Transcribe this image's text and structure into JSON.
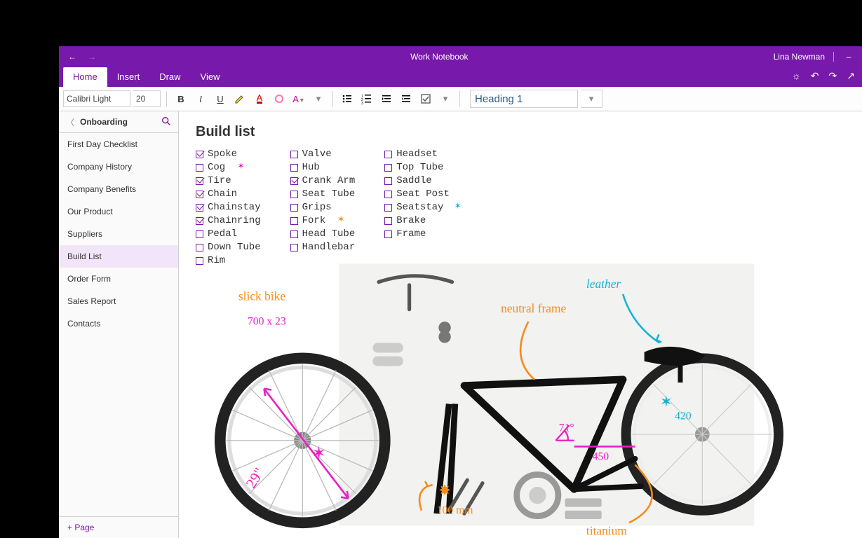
{
  "titlebar": {
    "title": "Work Notebook",
    "user": "Lina Newman"
  },
  "ribbon": {
    "tabs": [
      "Home",
      "Insert",
      "Draw",
      "View"
    ],
    "active": 0
  },
  "toolbar": {
    "font_name": "Calibri Light",
    "font_size": "20",
    "style_name": "Heading 1"
  },
  "sidebar": {
    "section": "Onboarding",
    "pages": [
      "First Day Checklist",
      "Company History",
      "Company Benefits",
      "Our Product",
      "Suppliers",
      "Build List",
      "Order Form",
      "Sales Report",
      "Contacts"
    ],
    "active_index": 5,
    "add_label": "Page"
  },
  "page": {
    "title": "Build list",
    "columns": [
      [
        {
          "label": "Spoke",
          "checked": true
        },
        {
          "label": "Cog",
          "checked": false,
          "star": "magenta"
        },
        {
          "label": "Tire",
          "checked": true
        },
        {
          "label": "Chain",
          "checked": true
        },
        {
          "label": "Chainstay",
          "checked": true
        },
        {
          "label": "Chainring",
          "checked": true
        },
        {
          "label": "Pedal",
          "checked": false
        },
        {
          "label": "Down Tube",
          "checked": false
        },
        {
          "label": "Rim",
          "checked": false
        }
      ],
      [
        {
          "label": "Valve",
          "checked": false
        },
        {
          "label": "Hub",
          "checked": false
        },
        {
          "label": "Crank Arm",
          "checked": true
        },
        {
          "label": "Seat Tube",
          "checked": false
        },
        {
          "label": "Grips",
          "checked": false
        },
        {
          "label": "Fork",
          "checked": false,
          "star": "orange"
        },
        {
          "label": "Head Tube",
          "checked": false
        },
        {
          "label": "Handlebar",
          "checked": false
        }
      ],
      [
        {
          "label": "Headset",
          "checked": false
        },
        {
          "label": "Top Tube",
          "checked": false
        },
        {
          "label": "Saddle",
          "checked": false
        },
        {
          "label": "Seat Post",
          "checked": false
        },
        {
          "label": "Seatstay",
          "checked": false,
          "star": "cyan"
        },
        {
          "label": "Brake",
          "checked": false
        },
        {
          "label": "Frame",
          "checked": false
        }
      ]
    ]
  },
  "annotations": {
    "slick_bike": "slick bike",
    "wheel_size": "700 x 23",
    "rim_size": "29\"",
    "neutral_frame": "neutral frame",
    "leather": "leather",
    "hundred_mm": "100 mm",
    "angle": "71°",
    "len_450": "450",
    "len_420": "420",
    "titanium": "titanium"
  }
}
